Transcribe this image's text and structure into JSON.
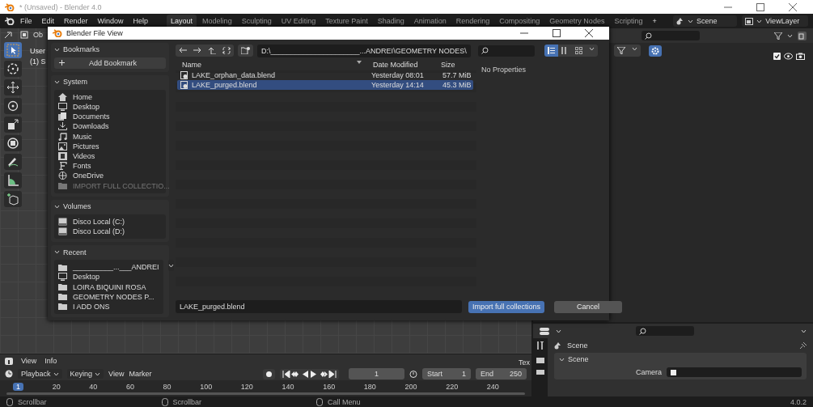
{
  "os_window": {
    "title": "* (Unsaved) - Blender 4.0"
  },
  "top_bar": {
    "menus": [
      "File",
      "Edit",
      "Render",
      "Window",
      "Help"
    ],
    "workspaces": [
      {
        "label": "Layout",
        "selected": true
      },
      {
        "label": "Modeling",
        "selected": false
      },
      {
        "label": "Sculpting",
        "selected": false
      },
      {
        "label": "UV Editing",
        "selected": false
      },
      {
        "label": "Texture Paint",
        "selected": false
      },
      {
        "label": "Shading",
        "selected": false
      },
      {
        "label": "Animation",
        "selected": false
      },
      {
        "label": "Rendering",
        "selected": false
      },
      {
        "label": "Compositing",
        "selected": false
      },
      {
        "label": "Geometry Nodes",
        "selected": false
      },
      {
        "label": "Scripting",
        "selected": false
      }
    ],
    "add_workspace": "+",
    "scene": "Scene",
    "view_layer": "ViewLayer"
  },
  "viewport": {
    "mode_label": "Ob",
    "overlay_lines": [
      "User",
      "(1) S"
    ],
    "tools": [
      {
        "selected": true
      },
      {
        "selected": false
      },
      {
        "selected": false
      },
      {
        "selected": false
      },
      {
        "selected": false
      },
      {
        "selected": false
      },
      {
        "selected": false
      },
      {
        "selected": false
      },
      {
        "selected": false
      }
    ]
  },
  "file_dialog": {
    "title": "Blender File View",
    "bookmarks": {
      "title": "Bookmarks",
      "add_label": "Add Bookmark"
    },
    "system": {
      "title": "System",
      "items": [
        {
          "label": "Home",
          "disabled": false
        },
        {
          "label": "Desktop",
          "disabled": false
        },
        {
          "label": "Documents",
          "disabled": false
        },
        {
          "label": "Downloads",
          "disabled": false
        },
        {
          "label": "Music",
          "disabled": false
        },
        {
          "label": "Pictures",
          "disabled": false
        },
        {
          "label": "Videos",
          "disabled": false
        },
        {
          "label": "Fonts",
          "disabled": false
        },
        {
          "label": "OneDrive",
          "disabled": false
        },
        {
          "label": "IMPORT FULL COLLECTIO...",
          "disabled": true
        }
      ]
    },
    "volumes": {
      "title": "Volumes",
      "items": [
        "Disco Local (C:)",
        "Disco Local (D:)"
      ]
    },
    "recent": {
      "title": "Recent",
      "items": [
        "__________...___ANDREI",
        "Desktop",
        "LOIRA BIQUINI ROSA",
        "GEOMETRY NODES P...",
        "I ADD ONS"
      ]
    },
    "path": "D:\\______________________...ANDREI\\GEOMETRY NODES\\",
    "view_modes": [
      {
        "selected": true
      },
      {
        "selected": false
      },
      {
        "selected": false
      }
    ],
    "columns": [
      "Name",
      "Date Modified",
      "Size"
    ],
    "rows": [
      {
        "name": "LAKE_orphan_data.blend",
        "date": "Yesterday 08:01",
        "size": "57.7 MiB",
        "selected": false
      },
      {
        "name": "LAKE_purged.blend",
        "date": "Yesterday 14:14",
        "size": "45.3 MiB",
        "selected": true
      }
    ],
    "properties_message": "No Properties",
    "filename": "LAKE_purged.blend",
    "confirm_label": "Import full collections",
    "cancel_label": "Cancel"
  },
  "info_editor": {
    "menus": [
      "View",
      "Info"
    ],
    "side_label": "Tex"
  },
  "timeline": {
    "menus": [
      "Playback",
      "Keying",
      "View",
      "Marker"
    ],
    "current_frame": "1",
    "start_label": "Start",
    "start": "1",
    "end_label": "End",
    "end": "250",
    "ruler": [
      {
        "label": "1",
        "selected": true
      },
      {
        "label": "20",
        "selected": false
      },
      {
        "label": "40",
        "selected": false
      },
      {
        "label": "60",
        "selected": false
      },
      {
        "label": "80",
        "selected": false
      },
      {
        "label": "100",
        "selected": false
      },
      {
        "label": "120",
        "selected": false
      },
      {
        "label": "140",
        "selected": false
      },
      {
        "label": "160",
        "selected": false
      },
      {
        "label": "180",
        "selected": false
      },
      {
        "label": "200",
        "selected": false
      },
      {
        "label": "220",
        "selected": false
      },
      {
        "label": "240",
        "selected": false
      }
    ]
  },
  "properties": {
    "context": "Scene",
    "panel": "Scene",
    "field_label": "Camera"
  },
  "status_bar": {
    "hints": [
      "Scrollbar",
      "Scrollbar",
      "Call Menu"
    ],
    "version": "4.0.2"
  }
}
